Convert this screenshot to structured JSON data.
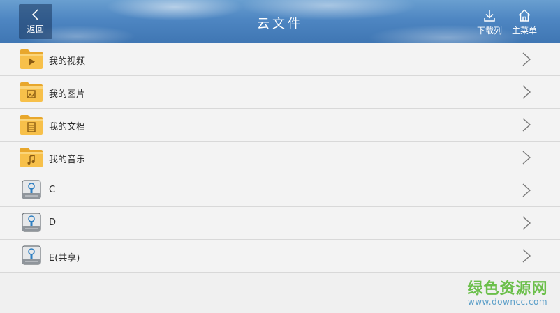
{
  "header": {
    "back_label": "返回",
    "title": "云文件",
    "download_label": "下载列",
    "home_label": "主菜单"
  },
  "items": [
    {
      "label": "我的视频",
      "icon": "folder-video-icon"
    },
    {
      "label": "我的图片",
      "icon": "folder-image-icon"
    },
    {
      "label": "我的文档",
      "icon": "folder-document-icon"
    },
    {
      "label": "我的音乐",
      "icon": "folder-music-icon"
    },
    {
      "label": "C",
      "icon": "drive-icon"
    },
    {
      "label": "D",
      "icon": "drive-icon"
    },
    {
      "label": "E(共享)",
      "icon": "drive-icon"
    }
  ],
  "watermark": {
    "site_name": "绿色资源网",
    "url": "www.downcc.com"
  },
  "colors": {
    "header": "#4e86c2",
    "folder": "#f7c04a",
    "watermark_green": "#6bbf4a",
    "watermark_blue": "#5a9ec8"
  }
}
